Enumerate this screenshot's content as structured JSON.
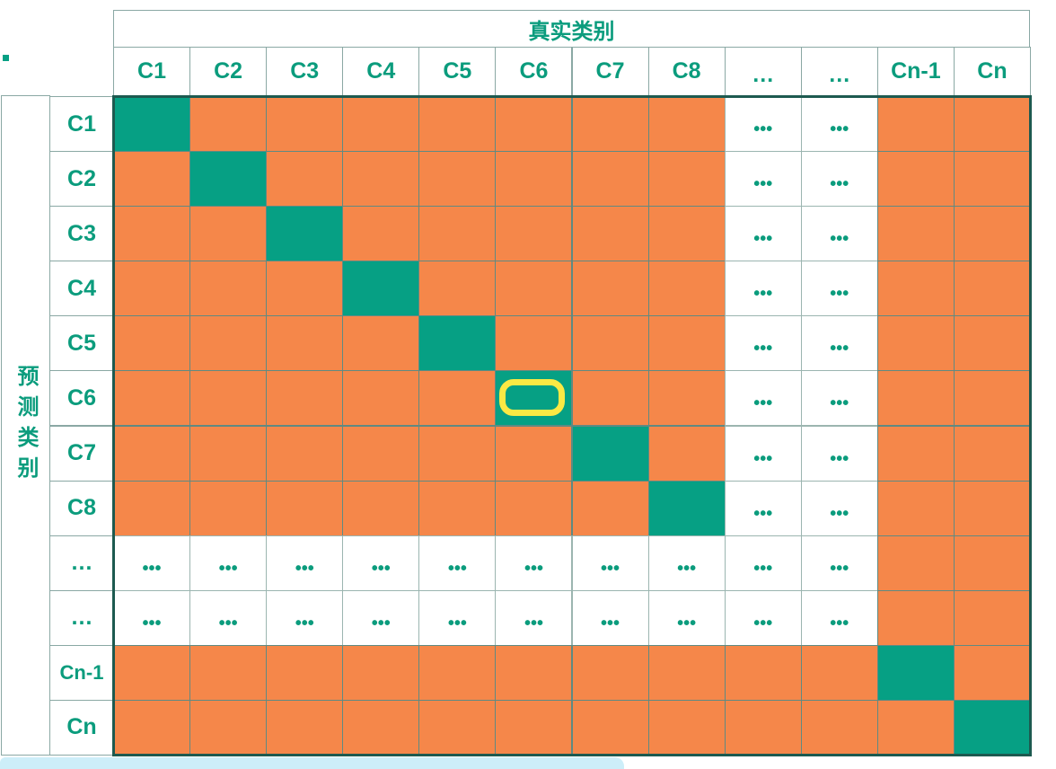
{
  "true_class_title": "真实类别",
  "pred_class_title": "预测类别",
  "col_labels": [
    "C1",
    "C2",
    "C3",
    "C4",
    "C5",
    "C6",
    "C7",
    "C8",
    "…",
    "…",
    "Cn-1",
    "Cn"
  ],
  "row_labels": [
    "C1",
    "C2",
    "C3",
    "C4",
    "C5",
    "C6",
    "C7",
    "C8",
    "…",
    "…",
    "Cn-1",
    "Cn"
  ],
  "colors": {
    "correct": "#06a084",
    "incorrect": "#f5874a",
    "highlight": "#fbe944",
    "text": "#0b9c7d"
  },
  "cell_legend": {
    "G": "correct",
    "O": "incorrect"
  },
  "matrix": [
    [
      "G",
      "O",
      "O",
      "O",
      "O",
      "O",
      "O",
      "O",
      "•••",
      "•••",
      "O",
      "O"
    ],
    [
      "O",
      "G",
      "O",
      "O",
      "O",
      "O",
      "O",
      "O",
      "•••",
      "•••",
      "O",
      "O"
    ],
    [
      "O",
      "O",
      "G",
      "O",
      "O",
      "O",
      "O",
      "O",
      "•••",
      "•••",
      "O",
      "O"
    ],
    [
      "O",
      "O",
      "O",
      "G",
      "O",
      "O",
      "O",
      "O",
      "•••",
      "•••",
      "O",
      "O"
    ],
    [
      "O",
      "O",
      "O",
      "O",
      "G",
      "O",
      "O",
      "O",
      "•••",
      "•••",
      "O",
      "O"
    ],
    [
      "O",
      "O",
      "O",
      "O",
      "O",
      "G",
      "O",
      "O",
      "•••",
      "•••",
      "O",
      "O"
    ],
    [
      "O",
      "O",
      "O",
      "O",
      "O",
      "O",
      "G",
      "O",
      "•••",
      "•••",
      "O",
      "O"
    ],
    [
      "O",
      "O",
      "O",
      "O",
      "O",
      "O",
      "O",
      "G",
      "•••",
      "•••",
      "O",
      "O"
    ],
    [
      "•••",
      "•••",
      "•••",
      "•••",
      "•••",
      "•••",
      "•••",
      "•••",
      "•••",
      "•••",
      "O",
      "O"
    ],
    [
      "•••",
      "•••",
      "•••",
      "•••",
      "•••",
      "•••",
      "•••",
      "•••",
      "•••",
      "•••",
      "O",
      "O"
    ],
    [
      "O",
      "O",
      "O",
      "O",
      "O",
      "O",
      "O",
      "O",
      "O",
      "O",
      "G",
      "O"
    ],
    [
      "O",
      "O",
      "O",
      "O",
      "O",
      "O",
      "O",
      "O",
      "O",
      "O",
      "O",
      "G"
    ]
  ],
  "highlighted_cell": {
    "row": "C6",
    "col": "C6"
  }
}
